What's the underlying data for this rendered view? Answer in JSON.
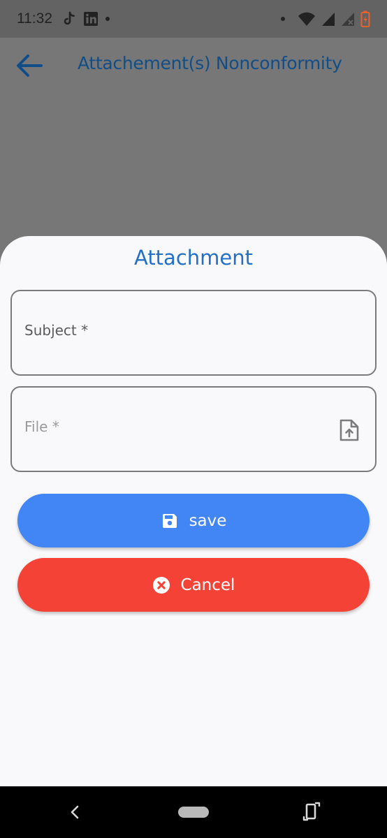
{
  "status_bar": {
    "time": "11:32",
    "left_icons": [
      "tiktok-icon",
      "linkedin-icon",
      "notification-dot"
    ],
    "right_icons": [
      "notification-dot",
      "wifi-icon",
      "signal-icon",
      "signal-off-icon",
      "battery-charging-icon"
    ]
  },
  "app_bar": {
    "title": "Attachement(s) Nonconformity",
    "back_icon": "arrow-left-icon"
  },
  "sheet": {
    "title": "Attachment",
    "subject_label": "Subject *",
    "file_label": "File *",
    "file_icon": "file-upload-icon",
    "save_label": "save",
    "save_icon": "floppy-disk-icon",
    "cancel_label": "Cancel",
    "cancel_icon": "x-circle-icon"
  },
  "nav_bar": {
    "icons": [
      "nav-back-icon",
      "home-pill",
      "rotate-icon"
    ]
  },
  "colors": {
    "primary": "#2470c6",
    "app_title": "#114e87",
    "save": "#4285f4",
    "cancel": "#f44336",
    "scrim": "#777777",
    "sheet_bg": "#f9f9fb"
  }
}
